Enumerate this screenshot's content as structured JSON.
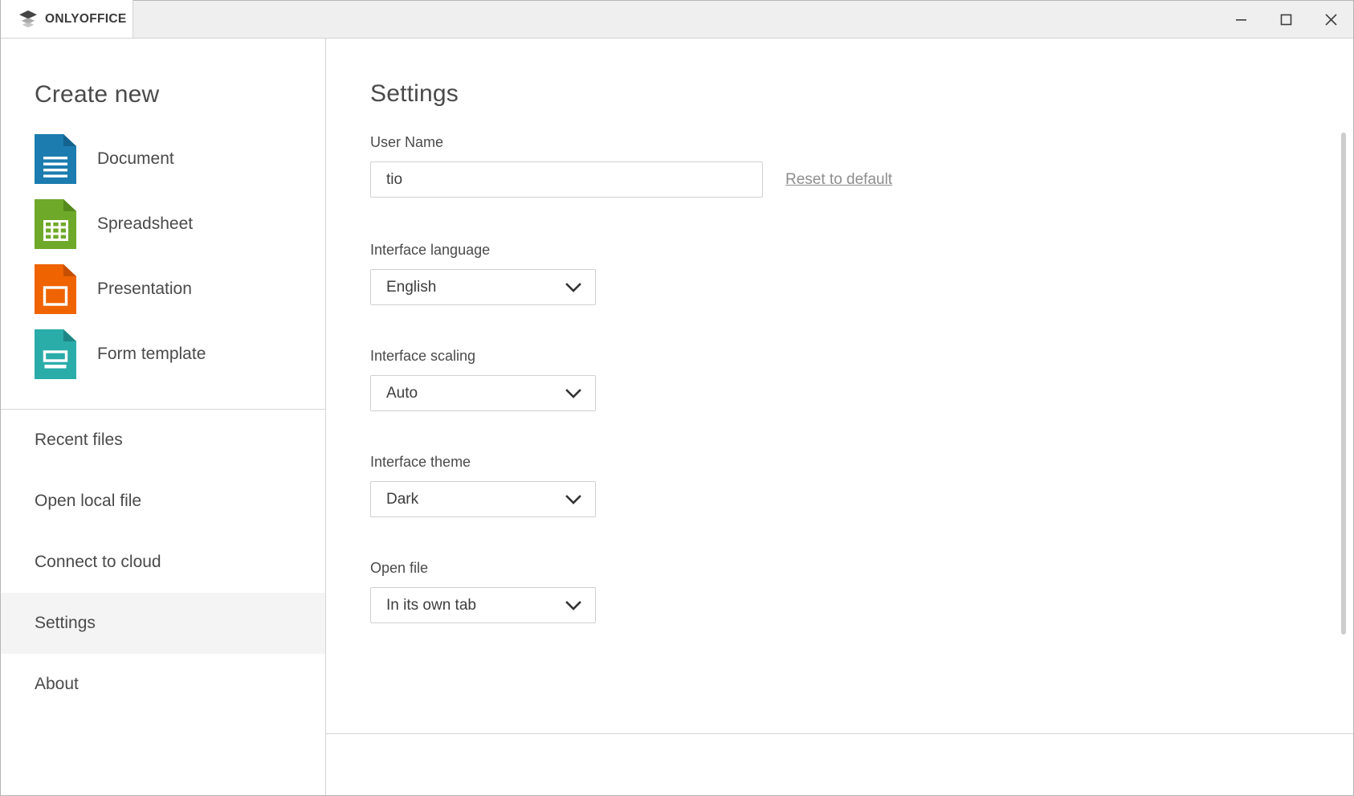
{
  "window": {
    "brand": "ONLYOFFICE",
    "brand_icon": "layers-stack-icon",
    "controls": {
      "minimize": "minimize-icon",
      "maximize": "maximize-icon",
      "close": "close-icon"
    }
  },
  "sidebar": {
    "create_new_title": "Create new",
    "create_items": [
      {
        "label": "Document",
        "icon": "document-file-icon",
        "color": "#1C7CAF"
      },
      {
        "label": "Spreadsheet",
        "icon": "spreadsheet-file-icon",
        "color": "#6FA929"
      },
      {
        "label": "Presentation",
        "icon": "presentation-file-icon",
        "color": "#EF6300"
      },
      {
        "label": "Form template",
        "icon": "form-template-file-icon",
        "color": "#2AACA9"
      }
    ],
    "nav_items": [
      {
        "label": "Recent files",
        "selected": false
      },
      {
        "label": "Open local file",
        "selected": false
      },
      {
        "label": "Connect to cloud",
        "selected": false
      },
      {
        "label": "Settings",
        "selected": true
      },
      {
        "label": "About",
        "selected": false
      }
    ]
  },
  "settings": {
    "title": "Settings",
    "user_name": {
      "label": "User Name",
      "value": "tio",
      "placeholder": "",
      "reset_link": "Reset to default"
    },
    "interface_language": {
      "label": "Interface language",
      "value": "English"
    },
    "interface_scaling": {
      "label": "Interface scaling",
      "value": "Auto"
    },
    "interface_theme": {
      "label": "Interface theme",
      "value": "Dark"
    },
    "open_file": {
      "label": "Open file",
      "value": "In its own tab"
    }
  }
}
